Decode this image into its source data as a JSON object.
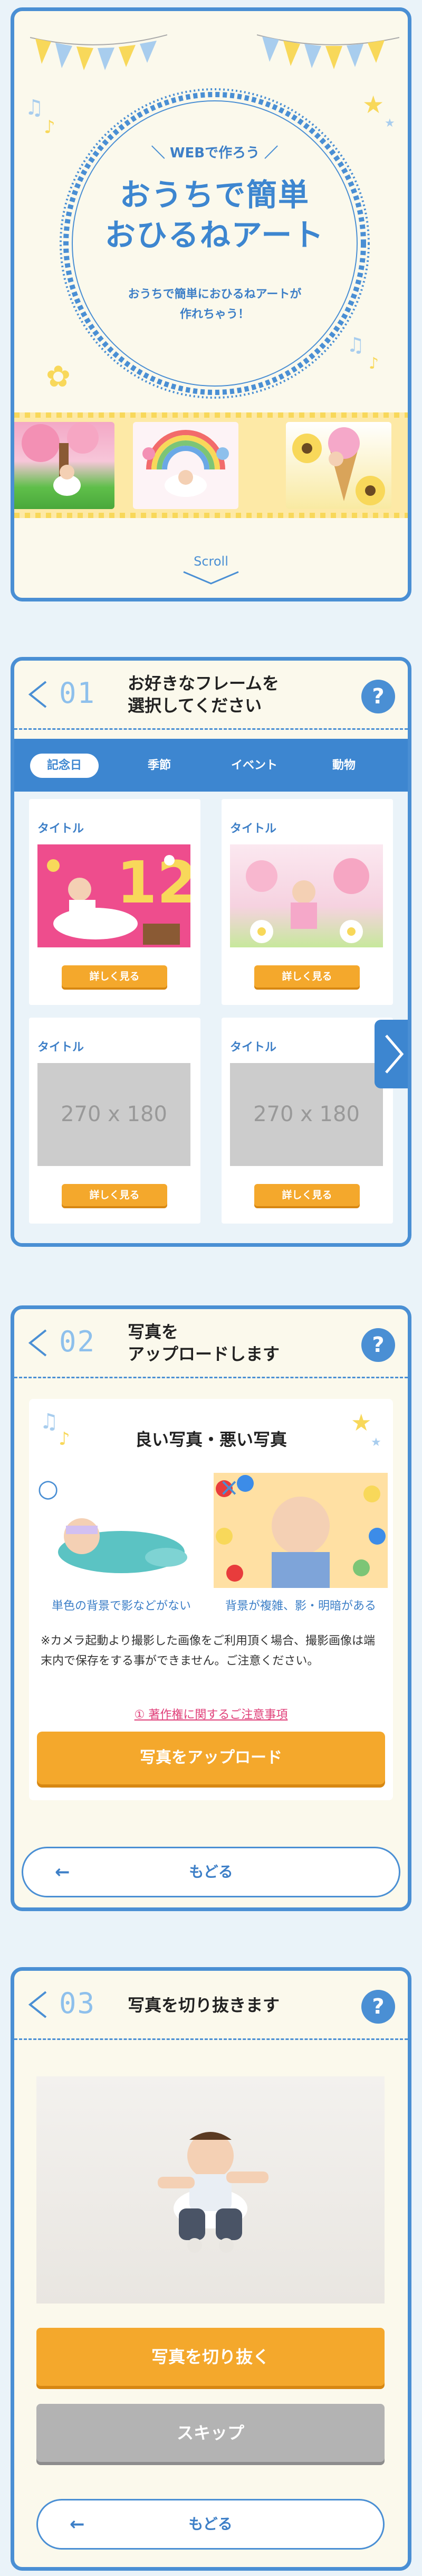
{
  "hero": {
    "tagline": "WEBで作ろう",
    "title_line1": "おうちで簡単",
    "title_line2": "おひるねアート",
    "desc_line1": "おうちで簡単におひるねアートが",
    "desc_line2": "作れちゃう！",
    "scroll_label": "Scroll"
  },
  "step1": {
    "number": "01",
    "title_line1": "お好きなフレームを",
    "title_line2": "選択してください",
    "help_label": "?",
    "tabs": [
      "記念日",
      "季節",
      "イベント",
      "動物"
    ],
    "active_tab": "記念日",
    "frames": [
      {
        "title": "タイトル",
        "button": "詳しく見る",
        "placeholder": ""
      },
      {
        "title": "タイトル",
        "button": "詳しく見る",
        "placeholder": ""
      },
      {
        "title": "タイトル",
        "button": "詳しく見る",
        "placeholder": "270 x 180"
      },
      {
        "title": "タイトル",
        "button": "詳しく見る",
        "placeholder": "270 x 180"
      }
    ]
  },
  "step2": {
    "number": "02",
    "title_line1": "写真を",
    "title_line2": "アップロードします",
    "help_label": "?",
    "panel_title": "良い写真・悪い写真",
    "good_caption": "単色の背景で影などがない",
    "bad_caption": "背景が複雑、影・明暗がある",
    "good_mark": "○",
    "bad_mark": "×",
    "note": "※カメラ起動より撮影した画像をご利用頂く場合、撮影画像は端末内で保存をする事ができません。ご注意ください。",
    "notice_link": "① 著作権に関するご注意事項",
    "upload_button": "写真をアップロード",
    "back_button": "もどる"
  },
  "step3": {
    "number": "03",
    "title": "写真を切り抜きます",
    "help_label": "?",
    "crop_button": "写真を切り抜く",
    "skip_button": "スキップ",
    "back_button": "もどる"
  },
  "colors": {
    "primary": "#4a8fd4",
    "accent": "#f4a82c",
    "cream": "#fbf9ec",
    "skip_gray": "#b3b3b3",
    "link_pink": "#e0407a"
  }
}
